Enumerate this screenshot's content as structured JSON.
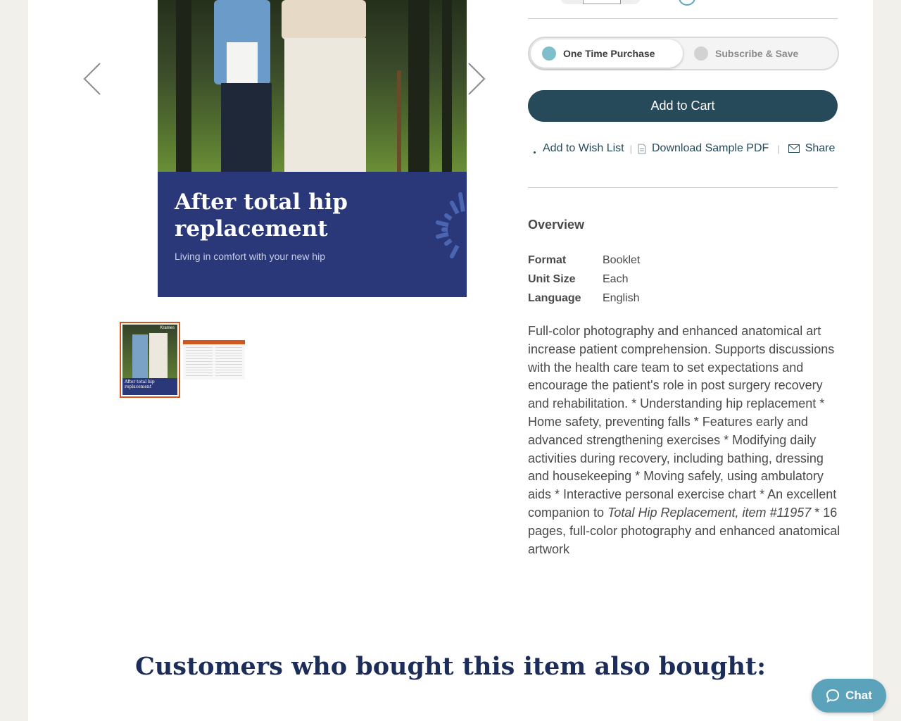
{
  "product_image": {
    "cover_title": "After total hip replacement",
    "cover_subtitle": "Living in comfort with your new hip",
    "thumb_title": "After total hip replacement",
    "thumb_brand": "Krames"
  },
  "purchase_options": {
    "one_time_label": "One Time Purchase",
    "subscribe_label": "Subscribe & Save",
    "selected": "One Time Purchase"
  },
  "cart": {
    "add_to_cart_label": "Add to Cart"
  },
  "actions": {
    "wish_list_label": "Add to Wish List",
    "download_label": "Download Sample PDF",
    "share_label": "Share",
    "separator": "|"
  },
  "overview": {
    "title": "Overview",
    "specs": [
      {
        "label": "Format",
        "value": "Booklet"
      },
      {
        "label": "Unit Size",
        "value": "Each"
      },
      {
        "label": "Language",
        "value": "English"
      }
    ],
    "description_before": "Full-color photography and enhanced anatomical art increase patient comprehension. Supports discussions with the health care team to set expectations and encourage the patient's role in post surgery recovery and rehabilitation. * Understanding hip replacement * Home safety, preventing falls * Features early and advanced strengthening exercises * Modifying daily activities during recovery, including bathing, dressing and housekeeping * Moving safely, using ambulatory aids * Interactive personal exercise chart * An excellent companion to ",
    "description_italic": "Total Hip Replacement, item #11957",
    "description_after": " * 16 pages, full-color photography and enhanced anatomical artwork"
  },
  "related": {
    "heading": "Customers who bought this item also bought:"
  },
  "chat": {
    "label": "Chat"
  },
  "colors": {
    "accent": "#264a5a",
    "brand_navy": "#2a3778",
    "highlight_orange": "#d3561f",
    "chat_blue": "#5aa3bb"
  },
  "icons": {
    "prev": "chevron-left-icon",
    "next": "chevron-right-icon",
    "download": "document-icon",
    "share": "envelope-icon",
    "chat": "speech-bubble-icon"
  }
}
